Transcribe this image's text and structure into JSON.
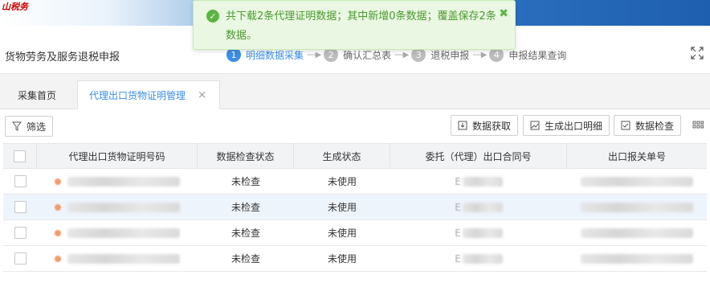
{
  "banner": {
    "logo_text": "山税务"
  },
  "header": {
    "title": "货物劳务及服务退税申报",
    "steps": [
      {
        "num": "1",
        "label": "明细数据采集"
      },
      {
        "num": "2",
        "label": "确认汇总表"
      },
      {
        "num": "3",
        "label": "退税申报"
      },
      {
        "num": "4",
        "label": "申报结果查询"
      }
    ],
    "step_arrow": "----▶"
  },
  "tabs": [
    {
      "label": "采集首页"
    },
    {
      "label": "代理出口货物证明管理",
      "close": "×"
    }
  ],
  "toolbar": {
    "filter_label": "筛选",
    "fetch_label": "数据获取",
    "generate_label": "生成出口明细",
    "check_label": "数据检查"
  },
  "table": {
    "columns": [
      "代理出口货物证明号码",
      "数据检查状态",
      "生成状态",
      "委托（代理）出口合同号",
      "出口报关单号"
    ],
    "rows": [
      {
        "check_status": "未检查",
        "gen_status": "未使用",
        "contract_prefix": "E"
      },
      {
        "check_status": "未检查",
        "gen_status": "未使用",
        "contract_prefix": "E"
      },
      {
        "check_status": "未检查",
        "gen_status": "未使用",
        "contract_prefix": "E"
      },
      {
        "check_status": "未检查",
        "gen_status": "未使用",
        "contract_prefix": "E"
      }
    ]
  },
  "toast": {
    "message": "共下载2条代理证明数据；其中新增0条数据；覆盖保存2条数据。",
    "icon": "check-circle-icon",
    "close": "✖"
  },
  "colors": {
    "accent": "#3a8ee6",
    "success": "#5ab543",
    "highlight_row": "#eef4fc"
  }
}
